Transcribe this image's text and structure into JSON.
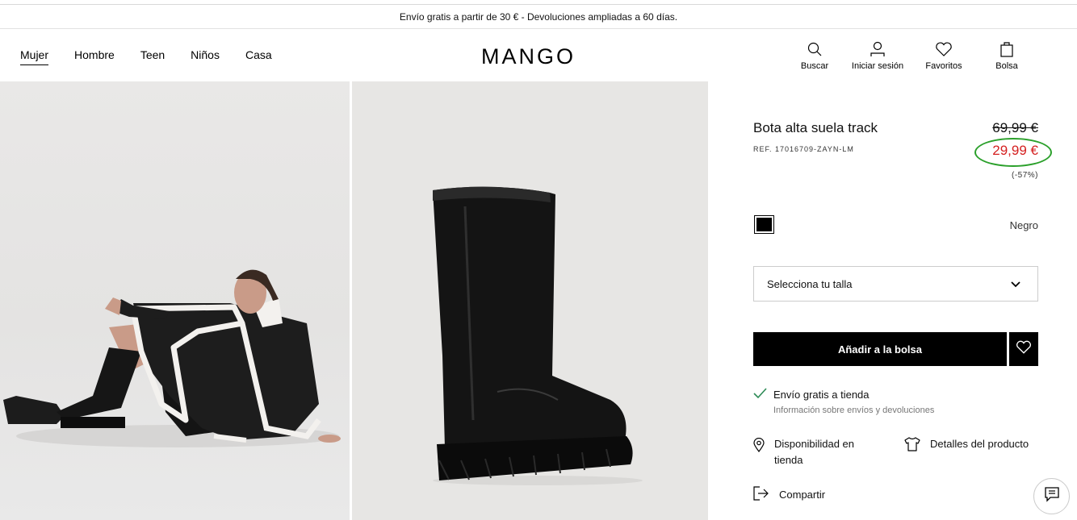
{
  "promo_banner": "Envío gratis a partir de 30 € - Devoluciones ampliadas a 60 días.",
  "nav": {
    "links": [
      "Mujer",
      "Hombre",
      "Teen",
      "Niños",
      "Casa"
    ],
    "logo": "MANGO",
    "actions": [
      {
        "label": "Buscar",
        "icon": "search-icon"
      },
      {
        "label": "Iniciar sesión",
        "icon": "user-icon"
      },
      {
        "label": "Favoritos",
        "icon": "heart-icon"
      },
      {
        "label": "Bolsa",
        "icon": "bag-icon"
      }
    ]
  },
  "product": {
    "title": "Bota alta suela track",
    "ref": "REF. 17016709-ZAYN-LM",
    "old_price": "69,99 €",
    "new_price": "29,99 €",
    "discount": "(-57%)",
    "color_name": "Negro",
    "color_swatch": "#000000",
    "size_placeholder": "Selecciona tu talla",
    "add_to_bag": "Añadir a la bolsa",
    "shipping_title": "Envío gratis a tienda",
    "shipping_link": "Información sobre envíos y devoluciones",
    "availability": "Disponibilidad en tienda",
    "details": "Detalles del producto",
    "share": "Compartir"
  },
  "colors": {
    "sale_price": "#d42020",
    "highlight_ring": "#2ba02b",
    "check": "#2e8b57"
  }
}
